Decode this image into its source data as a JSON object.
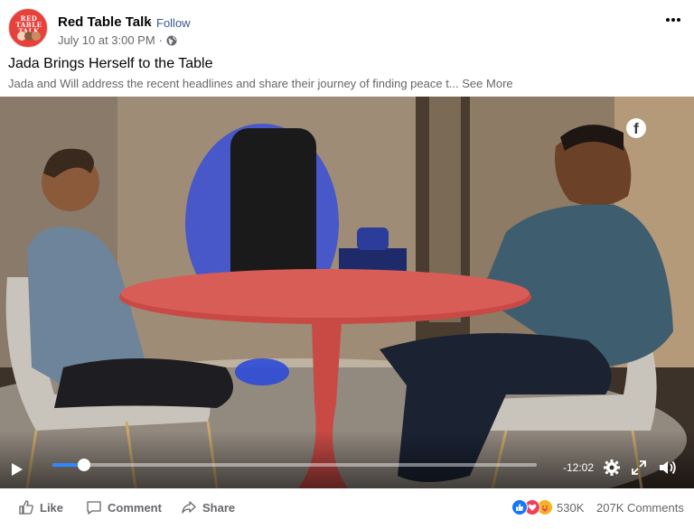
{
  "post": {
    "page_name": "Red Table Talk",
    "separator": "·",
    "follow_label": "Follow",
    "timestamp": "July 10 at 3:00 PM",
    "meta_sep": "·",
    "privacy_icon": "globe-icon",
    "more_icon": "more-options-icon",
    "title": "Jada Brings Herself to the Table",
    "description": "Jada and Will address the recent headlines and share their journey of finding peace t...",
    "see_more_label": "See More",
    "avatar_logo": "RED TABLE TALK"
  },
  "video": {
    "watermark_icon": "facebook-logo-icon",
    "watermark_glyph": "f",
    "progress": 0.065,
    "time_remaining": "-12:02",
    "accent_color": "#2d88ff"
  },
  "actions": {
    "like_label": "Like",
    "comment_label": "Comment",
    "share_label": "Share"
  },
  "engagement": {
    "reaction_icons": [
      "like-reaction-icon",
      "love-reaction-icon",
      "care-reaction-icon"
    ],
    "reaction_count": "530K",
    "comment_count": "207K Comments"
  }
}
